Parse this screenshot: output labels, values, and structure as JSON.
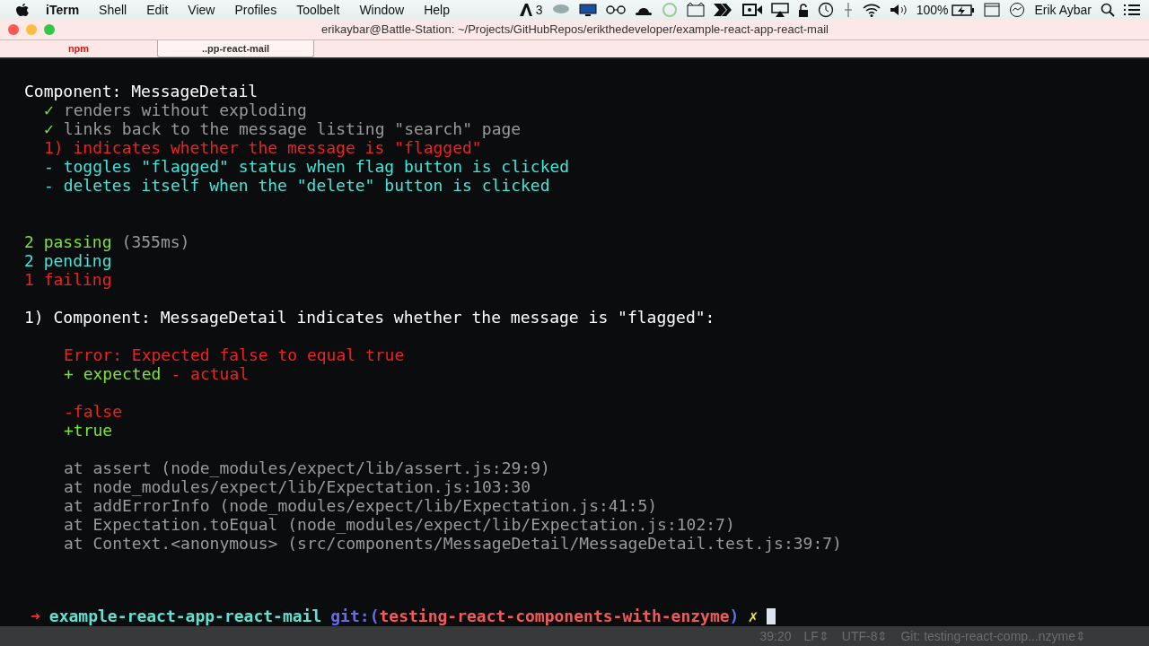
{
  "menu_bar": {
    "app": "iTerm",
    "items": [
      "Shell",
      "Edit",
      "View",
      "Profiles",
      "Toolbelt",
      "Window",
      "Help"
    ],
    "adobe_count": "3",
    "battery": "100%",
    "user": "Erik Aybar"
  },
  "window": {
    "title": "erikaybar@Battle-Station: ~/Projects/GitHubRepos/erikthedeveloper/example-react-app-react-mail"
  },
  "tabs": [
    {
      "label": "npm",
      "selected": false,
      "alert": true
    },
    {
      "label": "..pp-react-mail",
      "selected": true,
      "alert": false
    }
  ],
  "terminal": {
    "lines": [
      {
        "kind": "plain",
        "segments": [
          {
            "text": "Component: MessageDetail",
            "color": "#ffffff"
          }
        ]
      },
      {
        "kind": "test",
        "segments": [
          {
            "text": "✓",
            "color": "#7fe23a"
          },
          {
            "text": "renders without exploding",
            "color": "#9a9a9a"
          }
        ]
      },
      {
        "kind": "test",
        "segments": [
          {
            "text": "✓",
            "color": "#7fe23a"
          },
          {
            "text": "links back to the message listing \"search\" page",
            "color": "#9a9a9a"
          }
        ]
      },
      {
        "kind": "test",
        "segments": [
          {
            "text": "1) indicates whether the message is \"flagged\"",
            "color": "#ee2222"
          }
        ]
      },
      {
        "kind": "test",
        "segments": [
          {
            "text": "- toggles \"flagged\" status when flag button is clicked",
            "color": "#44e6d8"
          }
        ]
      },
      {
        "kind": "test",
        "segments": [
          {
            "text": "- deletes itself when the \"delete\" button is clicked",
            "color": "#44e6d8"
          }
        ]
      },
      {
        "kind": "blank"
      },
      {
        "kind": "blank"
      },
      {
        "kind": "plain",
        "segments": [
          {
            "text": "2 passing",
            "color": "#7fe23a"
          },
          {
            "text": "(355ms)",
            "color": "#9a9a9a"
          }
        ]
      },
      {
        "kind": "plain",
        "segments": [
          {
            "text": "2 pending",
            "color": "#44e6d8"
          }
        ]
      },
      {
        "kind": "plain",
        "segments": [
          {
            "text": "1 failing",
            "color": "#ee2222"
          }
        ]
      },
      {
        "kind": "blank"
      },
      {
        "kind": "plain",
        "segments": [
          {
            "text": "1) Component: MessageDetail indicates whether the message is \"flagged\":",
            "color": "#ffffff"
          }
        ]
      },
      {
        "kind": "blank"
      },
      {
        "kind": "detail",
        "segments": [
          {
            "text": "Error: Expected false to equal true",
            "color": "#ee2222"
          }
        ]
      },
      {
        "kind": "detail",
        "segments": [
          {
            "text": "+ expected",
            "color": "#7fe23a"
          },
          {
            "text": "- actual",
            "color": "#ee2222"
          }
        ]
      },
      {
        "kind": "blank"
      },
      {
        "kind": "detail",
        "segments": [
          {
            "text": "-false",
            "color": "#ee2222"
          }
        ]
      },
      {
        "kind": "detail",
        "segments": [
          {
            "text": "+true",
            "color": "#7fe23a"
          }
        ]
      },
      {
        "kind": "blank"
      },
      {
        "kind": "detail",
        "segments": [
          {
            "text": "at assert (node_modules/expect/lib/assert.js:29:9)",
            "color": "#9a9a9a"
          }
        ]
      },
      {
        "kind": "detail",
        "segments": [
          {
            "text": "at node_modules/expect/lib/Expectation.js:103:30",
            "color": "#9a9a9a"
          }
        ]
      },
      {
        "kind": "detail",
        "segments": [
          {
            "text": "at addErrorInfo (node_modules/expect/lib/Expectation.js:41:5)",
            "color": "#9a9a9a"
          }
        ]
      },
      {
        "kind": "detail",
        "segments": [
          {
            "text": "at Expectation.toEqual (node_modules/expect/lib/Expectation.js:102:7)",
            "color": "#9a9a9a"
          }
        ]
      },
      {
        "kind": "detail",
        "segments": [
          {
            "text": "at Context.<anonymous> (src/components/MessageDetail/MessageDetail.test.js:39:7)",
            "color": "#9a9a9a"
          }
        ]
      }
    ],
    "prompt": {
      "arrow": "➜",
      "directory": "example-react-app-react-mail",
      "git_open": "git:(",
      "branch": "testing-react-components-with-enzyme",
      "git_close": ")",
      "dirty": "✗"
    }
  },
  "status_bar": [
    "39:20",
    "LF⇕",
    "UTF-8⇕",
    "Git: testing-react-comp...nzyme⇕"
  ]
}
